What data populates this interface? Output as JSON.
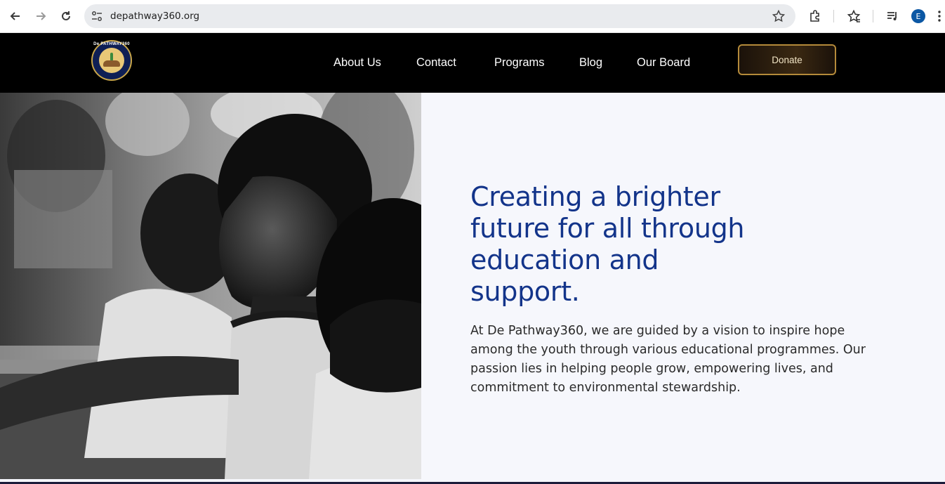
{
  "browser": {
    "url": "depathway360.org",
    "profile_initial": "E"
  },
  "site": {
    "logo_text": "De PATHWAY360",
    "nav": [
      "About Us",
      "Contact",
      "Programs",
      "Blog",
      "Our Board"
    ],
    "donate_label": "Donate"
  },
  "hero": {
    "headline_lines": [
      "Creating a brighter",
      "future for all through",
      "education and",
      "support."
    ],
    "body_lines": [
      "At De Pathway360, we are guided by a vision to inspire hope",
      "among the youth through various educational programmes. Our",
      "passion lies in helping people grow, empowering lives, and",
      "commitment to environmental stewardship."
    ]
  },
  "colors": {
    "accent": "#13348a",
    "header_bg": "#000000",
    "donate_border": "#b48a3a",
    "hero_bg": "#f6f7fc"
  },
  "icons": [
    "back-icon",
    "forward-icon",
    "reload-icon",
    "site-info-icon",
    "bookmark-star-icon",
    "extensions-icon",
    "bookmarks-icon",
    "media-icon",
    "menu-icon"
  ]
}
